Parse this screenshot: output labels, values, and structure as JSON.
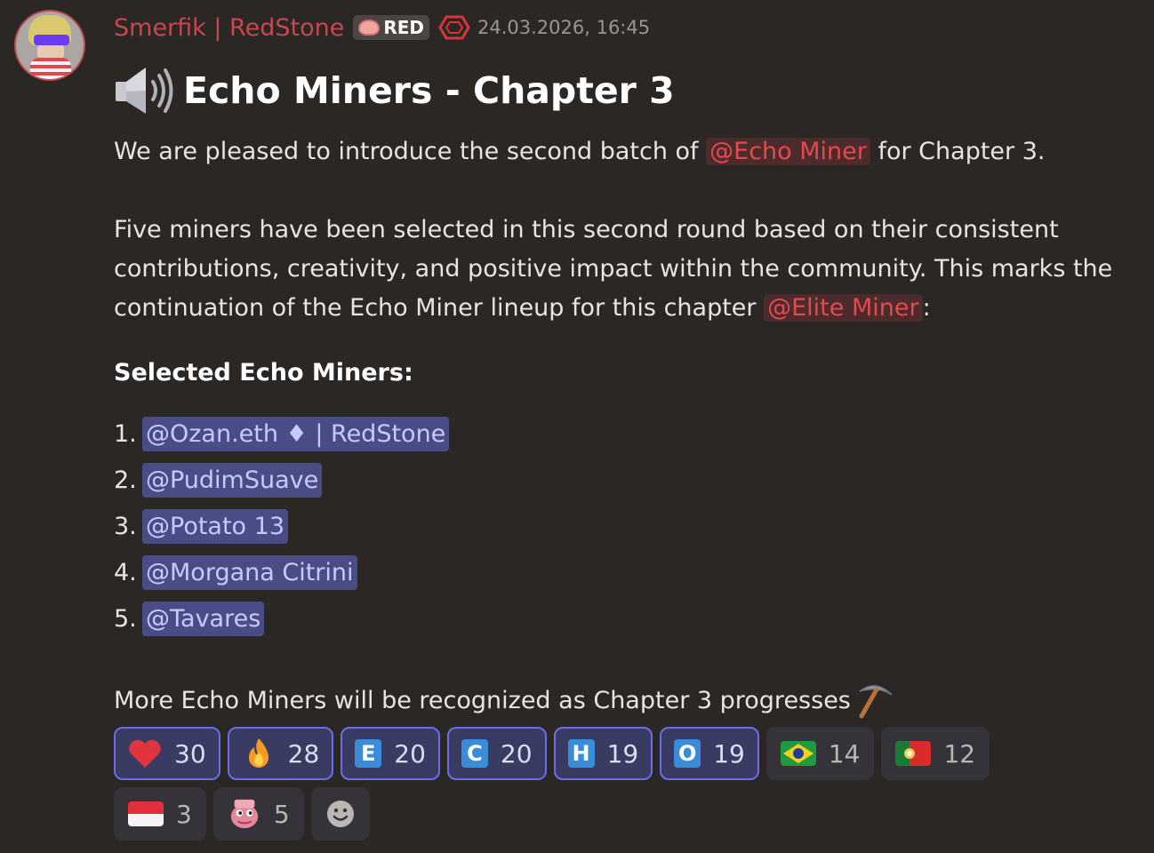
{
  "author": {
    "name": "Smerfik | RedStone",
    "role_tag": "RED",
    "timestamp": "24.03.2026, 16:45",
    "name_color": "#c8474c"
  },
  "message": {
    "title": "Echo Miners - Chapter 3",
    "title_icon": "speaker-icon",
    "p1_before": "We are pleased to introduce the second batch of ",
    "p1_mention": "@Echo Miner",
    "p1_after": " for Chapter 3.",
    "p2_line1": "Five miners have been selected in this second round based on their consistent",
    "p2_line2": "contributions, creativity, and positive impact within the community. This marks the",
    "p2_line3_before": "continuation of the Echo Miner lineup for this chapter ",
    "p2_mention": "@Elite Miner",
    "p2_line3_after": ":",
    "subheading": "Selected Echo Miners:",
    "miners": [
      {
        "num": "1.",
        "name": "@Ozan.eth ♦ | RedStone"
      },
      {
        "num": "2.",
        "name": "@PudimSuave"
      },
      {
        "num": "3.",
        "name": "@Potato 13"
      },
      {
        "num": "4.",
        "name": "@Morgana Citrini"
      },
      {
        "num": "5.",
        "name": "@Tavares"
      }
    ],
    "closing": "More Echo Miners will be recognized as Chapter 3 progresses",
    "closing_icon": "pickaxe-icon"
  },
  "reactions": [
    {
      "emoji": "heart-icon",
      "count": "30",
      "active": true
    },
    {
      "emoji": "fire-icon",
      "count": "28",
      "active": true
    },
    {
      "emoji": "letter-e-icon",
      "letter": "E",
      "count": "20",
      "active": true
    },
    {
      "emoji": "letter-c-icon",
      "letter": "C",
      "count": "20",
      "active": true
    },
    {
      "emoji": "letter-h-icon",
      "letter": "H",
      "count": "19",
      "active": true
    },
    {
      "emoji": "letter-o-icon",
      "letter": "O",
      "count": "19",
      "active": true
    },
    {
      "emoji": "brazil-flag-icon",
      "count": "14",
      "active": false
    },
    {
      "emoji": "portugal-flag-icon",
      "count": "12",
      "active": false
    },
    {
      "emoji": "indonesia-flag-icon",
      "count": "3",
      "active": false
    },
    {
      "emoji": "pepe-icon",
      "count": "5",
      "active": false
    }
  ],
  "add_reaction_icon": "smiley-add-icon",
  "colors": {
    "background": "#2b2725",
    "mention_red": "#e4494d",
    "mention_blue": "#c6cbff",
    "reaction_active_border": "#6a6ee8"
  }
}
